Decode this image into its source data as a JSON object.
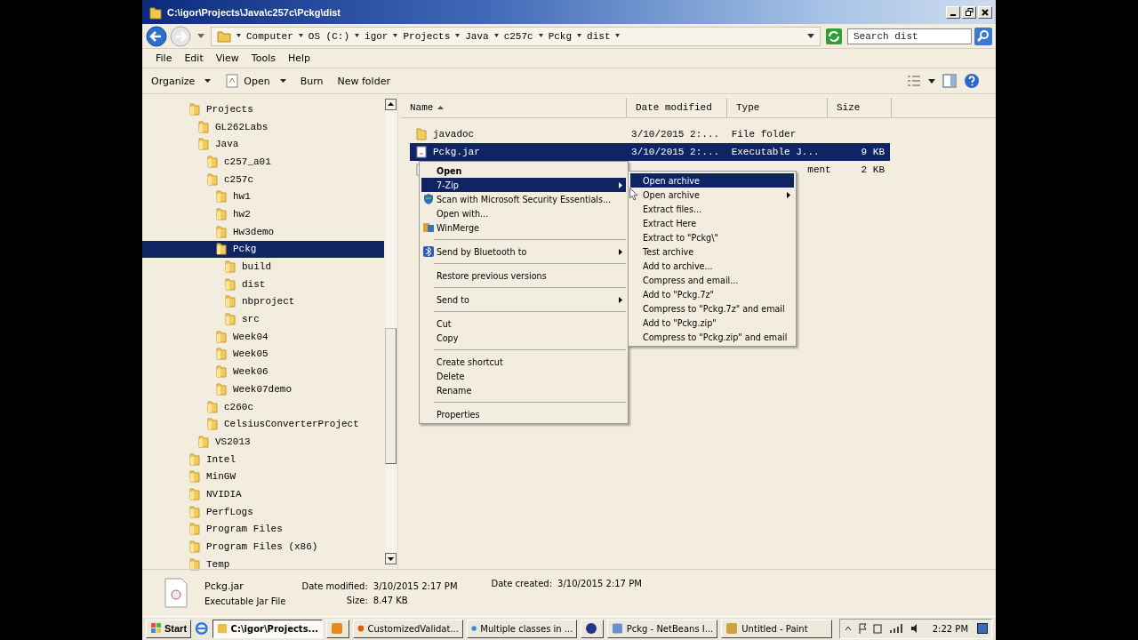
{
  "window": {
    "title": "C:\\igor\\Projects\\Java\\c257c\\Pckg\\dist"
  },
  "address": {
    "crumbs": [
      "Computer",
      "OS (C:)",
      "igor",
      "Projects",
      "Java",
      "c257c",
      "Pckg",
      "dist"
    ]
  },
  "search": {
    "placeholder": "Search dist"
  },
  "menu_bar": [
    "File",
    "Edit",
    "View",
    "Tools",
    "Help"
  ],
  "toolbar": [
    {
      "label": "Organize",
      "kind": "dropdown"
    },
    {
      "label": "Open",
      "kind": "open"
    },
    {
      "label": "Burn",
      "kind": "plain"
    },
    {
      "label": "New folder",
      "kind": "plain"
    }
  ],
  "tree": [
    {
      "name": "Projects",
      "selected": false,
      "children": [
        {
          "name": "GL262Labs",
          "selected": false
        },
        {
          "name": "Java",
          "selected": false,
          "children": [
            {
              "name": "c257_a01",
              "selected": false
            },
            {
              "name": "c257c",
              "selected": false,
              "children": [
                {
                  "name": "hw1",
                  "selected": false
                },
                {
                  "name": "hw2",
                  "selected": false
                },
                {
                  "name": "Hw3demo",
                  "selected": false
                },
                {
                  "name": "Pckg",
                  "selected": true,
                  "children": [
                    {
                      "name": "build",
                      "selected": false
                    },
                    {
                      "name": "dist",
                      "selected": false
                    },
                    {
                      "name": "nbproject",
                      "selected": false
                    },
                    {
                      "name": "src",
                      "selected": false
                    }
                  ]
                },
                {
                  "name": "Week04",
                  "selected": false
                },
                {
                  "name": "Week05",
                  "selected": false
                },
                {
                  "name": "Week06",
                  "selected": false
                },
                {
                  "name": "Week07demo",
                  "selected": false
                }
              ]
            },
            {
              "name": "c260c",
              "selected": false
            },
            {
              "name": "CelsiusConverterProject",
              "selected": false
            }
          ]
        },
        {
          "name": "VS2013",
          "selected": false
        }
      ]
    },
    {
      "name": "Intel",
      "selected": false
    },
    {
      "name": "MinGW",
      "selected": false
    },
    {
      "name": "NVIDIA",
      "selected": false
    },
    {
      "name": "PerfLogs",
      "selected": false
    },
    {
      "name": "Program Files",
      "selected": false
    },
    {
      "name": "Program Files (x86)",
      "selected": false
    },
    {
      "name": "Temp",
      "selected": false
    }
  ],
  "table": {
    "columns": [
      {
        "label": "Name",
        "sorted": true
      },
      {
        "label": "Date modified",
        "sorted": false
      },
      {
        "label": "Type",
        "sorted": false
      },
      {
        "label": "Size",
        "sorted": false
      }
    ],
    "rows": [
      {
        "kind": "folder",
        "name": "javadoc",
        "date": "3/10/2015 2:...",
        "type": "File folder",
        "selected": false
      },
      {
        "kind": "jar",
        "name": "Pckg.jar",
        "date": "3/10/2015 2:...",
        "type": "Executable J...",
        "size": "9 KB",
        "selected": true
      },
      {
        "kind": "text",
        "type": "ment",
        "size": "2 KB",
        "selected": false
      }
    ]
  },
  "context_menu": [
    {
      "kind": "plain",
      "label": "Open",
      "bold": true,
      "submenu": false,
      "selected": false
    },
    {
      "kind": "plain",
      "label": "7-Zip",
      "bold": false,
      "submenu": true,
      "selected": true
    },
    {
      "kind": "scan",
      "label": "Scan with Microsoft Security Essentials...",
      "bold": false,
      "submenu": false,
      "selected": false
    },
    {
      "kind": "plain",
      "label": "Open with...",
      "bold": false,
      "submenu": false,
      "selected": false
    },
    {
      "kind": "merge",
      "label": "WinMerge",
      "bold": false,
      "submenu": false,
      "selected": false
    },
    {
      "kind": "separator"
    },
    {
      "kind": "bluetooth",
      "label": "Send by Bluetooth to",
      "bold": false,
      "submenu": true,
      "selected": false
    },
    {
      "kind": "separator"
    },
    {
      "kind": "plain",
      "label": "Restore previous versions",
      "bold": false,
      "submenu": false,
      "selected": false
    },
    {
      "kind": "separator"
    },
    {
      "kind": "plain",
      "label": "Send to",
      "bold": false,
      "submenu": true,
      "selected": false
    },
    {
      "kind": "separator"
    },
    {
      "kind": "plain",
      "label": "Cut",
      "bold": false,
      "submenu": false,
      "selected": false
    },
    {
      "kind": "plain",
      "label": "Copy",
      "bold": false,
      "submenu": false,
      "selected": false
    },
    {
      "kind": "separator"
    },
    {
      "kind": "plain",
      "label": "Create shortcut",
      "bold": false,
      "submenu": false,
      "selected": false
    },
    {
      "kind": "plain",
      "label": "Delete",
      "bold": false,
      "submenu": false,
      "selected": false
    },
    {
      "kind": "plain",
      "label": "Rename",
      "bold": false,
      "submenu": false,
      "selected": false
    },
    {
      "kind": "separator"
    },
    {
      "kind": "plain",
      "label": "Properties",
      "bold": false,
      "submenu": false,
      "selected": false
    }
  ],
  "submenu": [
    {
      "label": "Open archive",
      "submenu": false,
      "selected": true
    },
    {
      "label": "Open archive",
      "submenu": true,
      "selected": false
    },
    {
      "label": "Extract files...",
      "submenu": false,
      "selected": false
    },
    {
      "label": "Extract Here",
      "submenu": false,
      "selected": false
    },
    {
      "label": "Extract to \"Pckg\\\"",
      "submenu": false,
      "selected": false
    },
    {
      "label": "Test archive",
      "submenu": false,
      "selected": false
    },
    {
      "label": "Add to archive...",
      "submenu": false,
      "selected": false
    },
    {
      "label": "Compress and email...",
      "submenu": false,
      "selected": false
    },
    {
      "label": "Add to \"Pckg.7z\"",
      "submenu": false,
      "selected": false
    },
    {
      "label": "Compress to \"Pckg.7z\" and email",
      "submenu": false,
      "selected": false
    },
    {
      "label": "Add to \"Pckg.zip\"",
      "submenu": false,
      "selected": false
    },
    {
      "label": "Compress to \"Pckg.zip\" and email",
      "submenu": false,
      "selected": false
    }
  ],
  "details": {
    "name": "Pckg.jar",
    "type": "Executable Jar File",
    "modified_label": "Date modified:",
    "modified": "3/10/2015 2:17 PM",
    "size_label": "Size:",
    "size": "8.47 KB",
    "created_label": "Date created:",
    "created": "3/10/2015 2:17 PM"
  },
  "taskbar": {
    "start": "Start",
    "buttons": [
      {
        "label": "C:\\igor\\Projects...",
        "kind": "folder",
        "selected": true
      },
      {
        "kind": "media",
        "selected": false
      },
      {
        "label": "CustomizedValidat...",
        "kind": "firefox",
        "selected": false
      },
      {
        "label": "Multiple classes in ...",
        "kind": "chrome",
        "selected": false
      },
      {
        "kind": "loop",
        "selected": false
      },
      {
        "label": "Pckg - NetBeans I...",
        "kind": "cube",
        "selected": false
      },
      {
        "label": "Untitled - Paint",
        "kind": "paint",
        "selected": false
      }
    ],
    "clock": "2:22 PM"
  }
}
